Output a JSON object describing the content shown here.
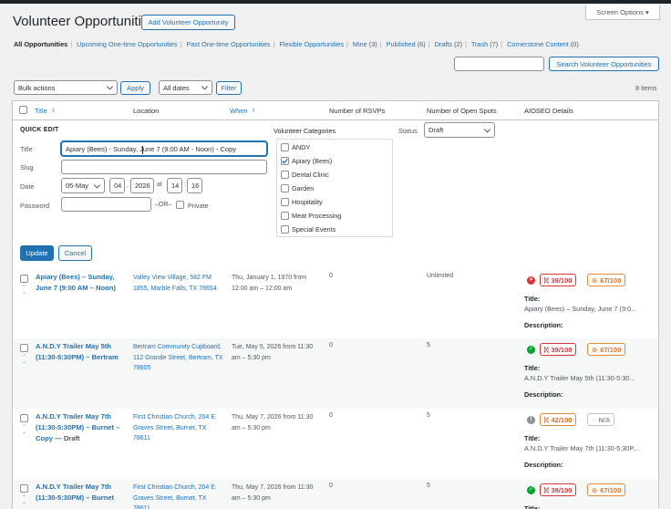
{
  "header": {
    "title": "Volunteer Opportunities",
    "add_button": "Add Volunteer Opportunity",
    "screen_options": "Screen Options ▾"
  },
  "views": [
    {
      "label": "All Opportunities",
      "count": ""
    },
    {
      "label": "Upcoming One-time Opportunities",
      "count": ""
    },
    {
      "label": "Past One-time Opportunities",
      "count": ""
    },
    {
      "label": "Flexible Opportunities",
      "count": ""
    },
    {
      "label": "Mine",
      "count": "(3)"
    },
    {
      "label": "Published",
      "count": "(6)"
    },
    {
      "label": "Drafts",
      "count": "(2)"
    },
    {
      "label": "Trash",
      "count": "(7)"
    },
    {
      "label": "Cornerstone Content",
      "count": "(0)"
    }
  ],
  "search": {
    "value": "",
    "button": "Search Volunteer Opportunities"
  },
  "tablenav": {
    "bulk_actions": "Bulk actions",
    "apply": "Apply",
    "dates": "All dates",
    "filter": "Filter",
    "items": "8 items"
  },
  "columns": {
    "title": "Title",
    "location": "Location",
    "when": "When",
    "rsvps": "Number of RSVPs",
    "spots": "Number of Open Spots",
    "aioseo": "AIOSEO Details"
  },
  "quick_edit": {
    "heading": "QUICK EDIT",
    "title_label": "Title",
    "title_value": "Apiary (Bees) - Sunday, June 7 (9:00 AM - Noon) - Copy",
    "slug_label": "Slug",
    "slug_value": "",
    "date_label": "Date",
    "month": "05-May",
    "day": "04",
    "year": "2026",
    "at": "at",
    "hour": "14",
    "minute": "16",
    "password_label": "Password",
    "password_value": "",
    "or": "–OR–",
    "private_label": "Private",
    "categories_label": "Volunteer Categories",
    "categories": [
      {
        "label": "ANDY",
        "checked": false
      },
      {
        "label": "Apiary (Bees)",
        "checked": true
      },
      {
        "label": "Dental Clinic",
        "checked": false
      },
      {
        "label": "Garden",
        "checked": false
      },
      {
        "label": "Hospitality",
        "checked": false
      },
      {
        "label": "Meat Processing",
        "checked": false
      },
      {
        "label": "Special Events",
        "checked": false
      }
    ],
    "status_label": "Status",
    "status_value": "Draft",
    "update": "Update",
    "cancel": "Cancel"
  },
  "rows": [
    {
      "title": "Apiary (Bees) – Sunday, June 7 (9:00 AM – Noon)",
      "state": "",
      "location": "Valley View Village, 582 FM 1855, Marble Falls, TX 78654",
      "when": "Thu, January 1, 1970 from 12:00 am – 12:00 am",
      "rsvps": "0",
      "spots": "Unlimited",
      "status_icon": "x-circle-icon",
      "status_color": "#d63638",
      "score1": "39/100",
      "score1_style": "red",
      "score2": "67/100",
      "score2_style": "orange",
      "seo_title_label": "Title:",
      "seo_title": "Apiary (Bees) – Sunday, June 7 (9:0...",
      "seo_desc_label": "Description:"
    },
    {
      "title": "A.N.D.Y Trailer May 5th (11:30-5:30PM) – Bertram",
      "state": "",
      "location": "Bertram Community Cupboard, 112 Grande Street, Bertram, TX 78605",
      "when": "Tue, May 5, 2026 from 11:30 am – 5:30 pm",
      "rsvps": "0",
      "spots": "5",
      "status_icon": "check-circle-icon",
      "status_color": "#00a32a",
      "score1": "39/100",
      "score1_style": "red",
      "score2": "67/100",
      "score2_style": "orange",
      "seo_title_label": "Title:",
      "seo_title": "A.N.D.Y Trailer May 5th (11:30-5:30...",
      "seo_desc_label": "Description:"
    },
    {
      "title": "A.N.D.Y Trailer May 7th (11:30-5:30PM) – Burnet – Copy",
      "state": "— Draft",
      "location": "First Christian Church, 204 E. Graves Street, Burnet, TX 78611",
      "when": "Thu, May 7, 2026 from 11:30 am – 5:30 pm",
      "rsvps": "0",
      "spots": "5",
      "status_icon": "info-circle-icon",
      "status_color": "#8c8f94",
      "score1": "42/100",
      "score1_style": "orange",
      "score2": "N/A",
      "score2_style": "gray",
      "seo_title_label": "Title:",
      "seo_title": "A.N.D.Y Trailer May 7th (11:30-5:30P...",
      "seo_desc_label": "Description:"
    },
    {
      "title": "A.N.D.Y Trailer May 7th (11:30-5:30PM) – Burnet",
      "state": "",
      "location": "First Christian Church, 204 E. Graves Street, Burnet, TX 78611",
      "when": "Thu, May 7, 2026 from 11:30 am – 5:30 pm",
      "rsvps": "0",
      "spots": "5",
      "status_icon": "check-circle-icon",
      "status_color": "#00a32a",
      "score1": "39/100",
      "score1_style": "red",
      "score2": "67/100",
      "score2_style": "orange",
      "seo_title_label": "Title:",
      "seo_title": "",
      "seo_desc_label": ""
    }
  ]
}
